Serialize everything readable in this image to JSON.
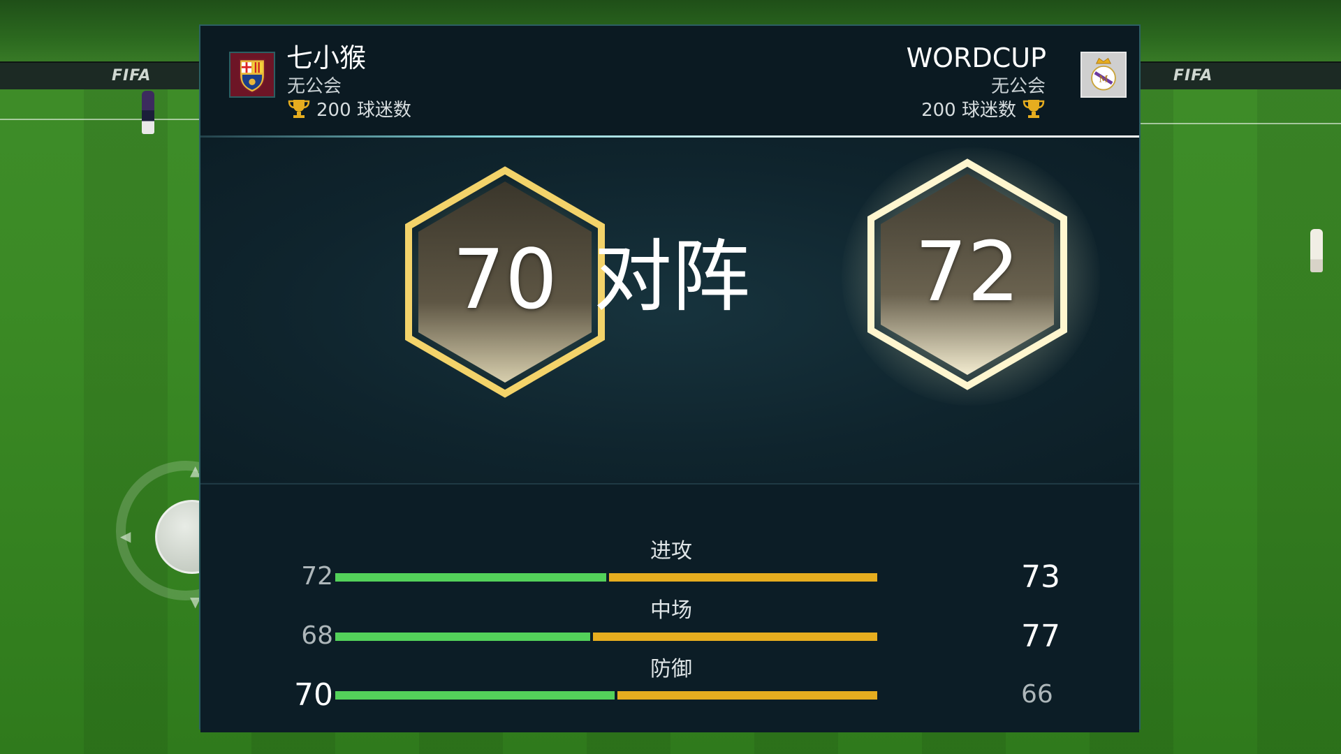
{
  "home": {
    "name": "七小猴",
    "guild": "无公会",
    "fans": "200 球迷数",
    "rating": "70",
    "crest_icon": "barcelona-crest-icon"
  },
  "away": {
    "name": "WORDCUP",
    "guild": "无公会",
    "fans": "200 球迷数",
    "rating": "72",
    "crest_icon": "real-madrid-crest-icon"
  },
  "vs_label": "对阵",
  "stats": [
    {
      "label": "进攻",
      "home": "72",
      "away": "73",
      "home_share": 0.5,
      "home_emphasis": false,
      "away_emphasis": true
    },
    {
      "label": "中场",
      "home": "68",
      "away": "77",
      "home_share": 0.47,
      "home_emphasis": false,
      "away_emphasis": true
    },
    {
      "label": "防御",
      "home": "70",
      "away": "66",
      "home_share": 0.515,
      "home_emphasis": true,
      "away_emphasis": false
    }
  ],
  "colors": {
    "home_bar": "#53d15a",
    "away_bar": "#e6ad1f",
    "panel": "#0e2029",
    "accent": "#7fd0d6"
  }
}
